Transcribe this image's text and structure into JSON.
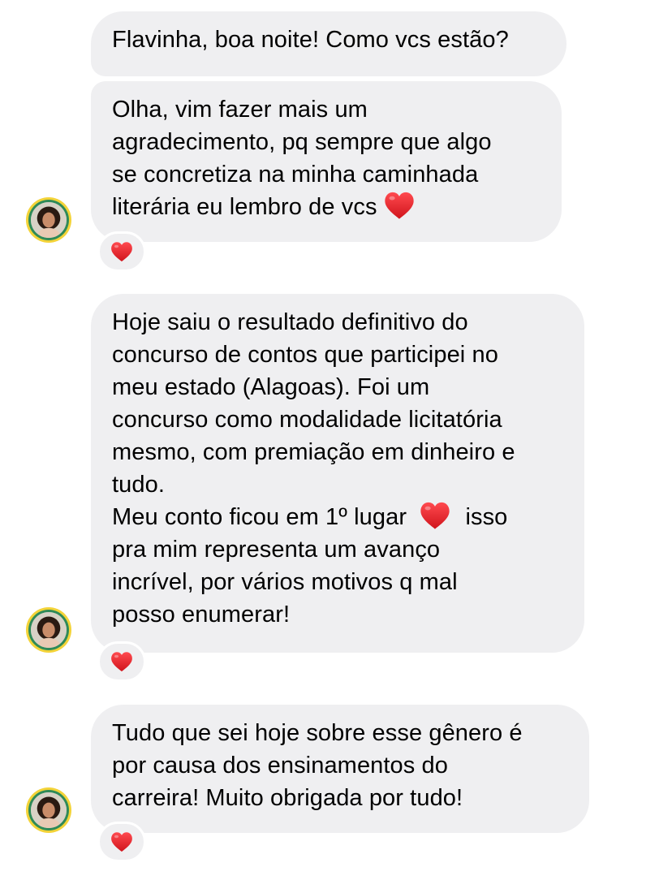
{
  "conversation": {
    "messages": [
      {
        "lines": [
          "Flavinha, boa noite! Como vcs estão?"
        ]
      },
      {
        "lines": [
          "Olha, vim fazer mais um",
          "agradecimento, pq sempre que algo",
          "se concretiza na minha caminhada",
          "literária eu lembro de vcs"
        ],
        "reaction": "heart-icon"
      },
      {
        "lines": [
          "Hoje saiu o resultado definitivo do",
          "concurso de contos que participei no",
          "meu estado (Alagoas). Foi um",
          "concurso como modalidade licitatória",
          "mesmo, com premiação em dinheiro e",
          "tudo.",
          "Meu conto ficou em 1º lugar",
          "isso",
          "pra mim representa um avanço",
          "incrível, por vários motivos q mal",
          "posso enumerar!"
        ],
        "reaction": "heart-icon"
      },
      {
        "lines": [
          "Tudo que sei hoje sobre esse gênero é",
          "por causa dos ensinamentos do",
          "carreira! Muito obrigada por tudo!"
        ],
        "reaction": "heart-icon"
      }
    ]
  },
  "colors": {
    "bubble_background": "#efeff1",
    "heart": "#e0262c",
    "avatar_ring": "#f3d338"
  }
}
